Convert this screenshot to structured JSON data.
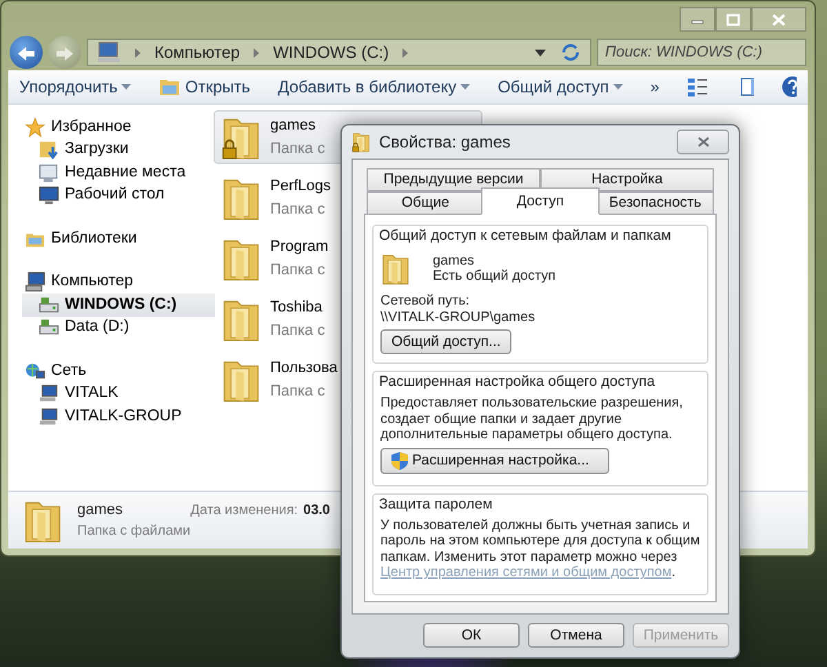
{
  "explorer": {
    "address": [
      "Компьютер",
      "WINDOWS (C:)"
    ],
    "search": {
      "placeholder": "Поиск: WINDOWS (C:)"
    },
    "toolbar": [
      {
        "label": "Упорядочить",
        "kind": "menu"
      },
      {
        "label": "Открыть",
        "kind": "open"
      },
      {
        "label": "Добавить в библиотеку",
        "kind": "menu"
      },
      {
        "label": "Общий доступ",
        "kind": "menu"
      },
      {
        "label": "»",
        "kind": "more"
      }
    ],
    "nav": [
      {
        "label": "Избранное",
        "kind": "star",
        "selected": false,
        "children": [
          {
            "label": "Загрузки",
            "kind": "downloads",
            "selected": false
          },
          {
            "label": "Недавние места",
            "kind": "recent",
            "selected": false
          },
          {
            "label": "Рабочий стол",
            "kind": "desktop",
            "selected": false
          }
        ]
      },
      {
        "label": "Библиотеки",
        "kind": "library",
        "selected": false
      },
      {
        "label": "Компьютер",
        "kind": "computer",
        "selected": false,
        "children": [
          {
            "label": "WINDOWS (C:)",
            "kind": "drive",
            "selected": true
          },
          {
            "label": "Data (D:)",
            "kind": "drive",
            "selected": false
          }
        ]
      },
      {
        "label": "Сеть",
        "kind": "network",
        "selected": false,
        "children": [
          {
            "label": "VITALK",
            "kind": "pc",
            "selected": false
          },
          {
            "label": "VITALK-GROUP",
            "kind": "pc",
            "selected": false
          }
        ]
      }
    ],
    "items": [
      {
        "name": "games",
        "type": "Папка с",
        "selected": true,
        "shared": true
      },
      {
        "name": "PerfLogs",
        "type": "Папка с",
        "selected": false,
        "shared": false
      },
      {
        "name": "Program",
        "type": "Папка с",
        "selected": false,
        "shared": false
      },
      {
        "name": "Toshiba",
        "type": "Папка с",
        "selected": false,
        "shared": false
      },
      {
        "name": "Пользова",
        "type": "Папка с",
        "selected": false,
        "shared": false
      }
    ],
    "details": {
      "name": "games",
      "type": "Папка с файлами",
      "date_label": "Дата изменения:",
      "date_value": "03.0"
    }
  },
  "dialog": {
    "title": "Свойства: games",
    "tab_rows": [
      [
        {
          "label": "Предыдущие версии",
          "selected": false
        },
        {
          "label": "Настройка",
          "selected": false
        }
      ],
      [
        {
          "label": "Общие",
          "selected": false
        },
        {
          "label": "Доступ",
          "selected": true
        },
        {
          "label": "Безопасность",
          "selected": false
        }
      ]
    ],
    "sharing": {
      "title": "Общий доступ к сетевым файлам и папкам",
      "folder": "games",
      "status": "Есть общий доступ",
      "path_label": "Сетевой путь:",
      "path": "\\\\VITALK-GROUP\\games",
      "button": "Общий доступ..."
    },
    "advanced": {
      "title": "Расширенная настройка общего доступа",
      "text": "Предоставляет пользовательские разрешения, создает общие папки и задает другие дополнительные параметры общего доступа.",
      "button": "Расширенная настройка..."
    },
    "password": {
      "title": "Защита паролем",
      "text": "У пользователей должны быть учетная запись и пароль на этом компьютере для доступа к общим папкам. Изменить этот параметр можно через",
      "link": "Центр управления сетями и общим доступом",
      "after": "."
    },
    "buttons": [
      {
        "label": "ОК",
        "disabled": false
      },
      {
        "label": "Отмена",
        "disabled": false
      },
      {
        "label": "Применить",
        "disabled": true
      }
    ]
  }
}
